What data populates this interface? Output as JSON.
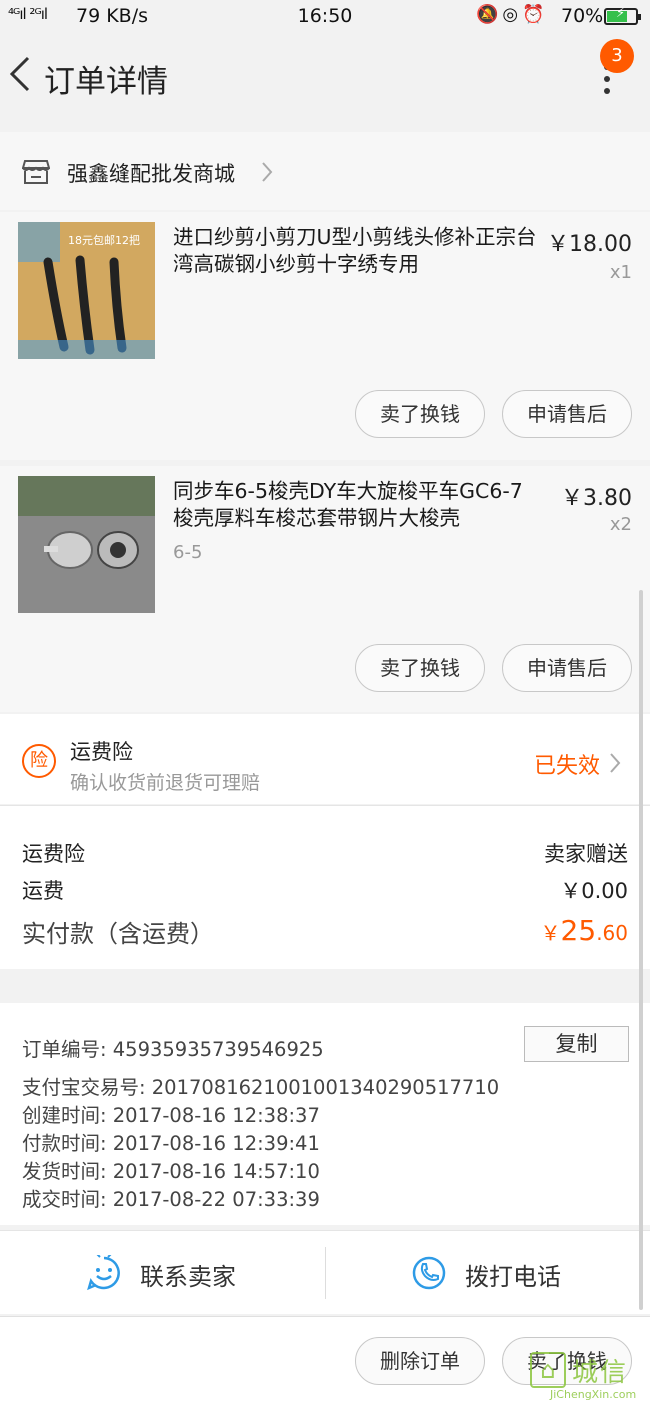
{
  "status_bar": {
    "signal": "⁴ᴳıl ²ᴳıl",
    "speed": "79 KB/s",
    "time": "16:50",
    "icons": "🔕◎⏰",
    "battery_pct": "70%",
    "battery_level": 0.7
  },
  "nav": {
    "title": "订单详情",
    "badge": "3"
  },
  "store": {
    "name": "强鑫缝配批发商城"
  },
  "items": [
    {
      "title": "进口纱剪小剪刀U型小剪线头修补正宗台湾高碳钢小纱剪十字绣专用",
      "price": "￥18.00",
      "qty": "x1",
      "variant": "",
      "thumb_text": "18元包邮12把",
      "buttons": [
        "卖了换钱",
        "申请售后"
      ]
    },
    {
      "title": "同步车6-5梭壳DY车大旋梭平车GC6-7梭壳厚料车梭芯套带钢片大梭壳",
      "price": "￥3.80",
      "qty": "x2",
      "variant": "6-5",
      "buttons": [
        "卖了换钱",
        "申请售后"
      ]
    }
  ],
  "insurance": {
    "icon_text": "险",
    "title": "运费险",
    "subtitle": "确认收货前退货可理赔",
    "status": "已失效"
  },
  "fees": {
    "insurance_label": "运费险",
    "insurance_value": "卖家赠送",
    "shipping_label": "运费",
    "shipping_value": "￥0.00",
    "total_label": "实付款（含运费）",
    "total_currency": "￥",
    "total_int": "25",
    "total_dec": ".60"
  },
  "order_info": {
    "order_no": "订单编号:   4593593573954692​5",
    "alipay_no": "支付宝交易号:   2017081621001001340290517710",
    "created": "创建时间:   2017-08-16 12:38:37",
    "paid": "付款时间:   2017-08-16 12:39:41",
    "shipped": "发货时间:   2017-08-16 14:57:10",
    "completed": "成交时间:   2017-08-22 07:33:39",
    "copy_label": "复制"
  },
  "contact": {
    "seller_label": "联系卖家",
    "call_label": "拨打电话"
  },
  "bottom": {
    "delete_label": "删除订单",
    "sell_label": "卖了换钱"
  },
  "watermark": {
    "cn": "城信",
    "en": "JiChengXin.com"
  },
  "colors": {
    "accent": "#ff5a00",
    "background": "#f2f2f2",
    "contact_blue": "#2e9be6"
  },
  "icons": {
    "back": "chevron-left-icon",
    "more": "more-vertical-icon",
    "store": "store-icon",
    "insurance": "insurance-icon",
    "chat": "chat-smile-icon",
    "phone": "phone-icon"
  }
}
